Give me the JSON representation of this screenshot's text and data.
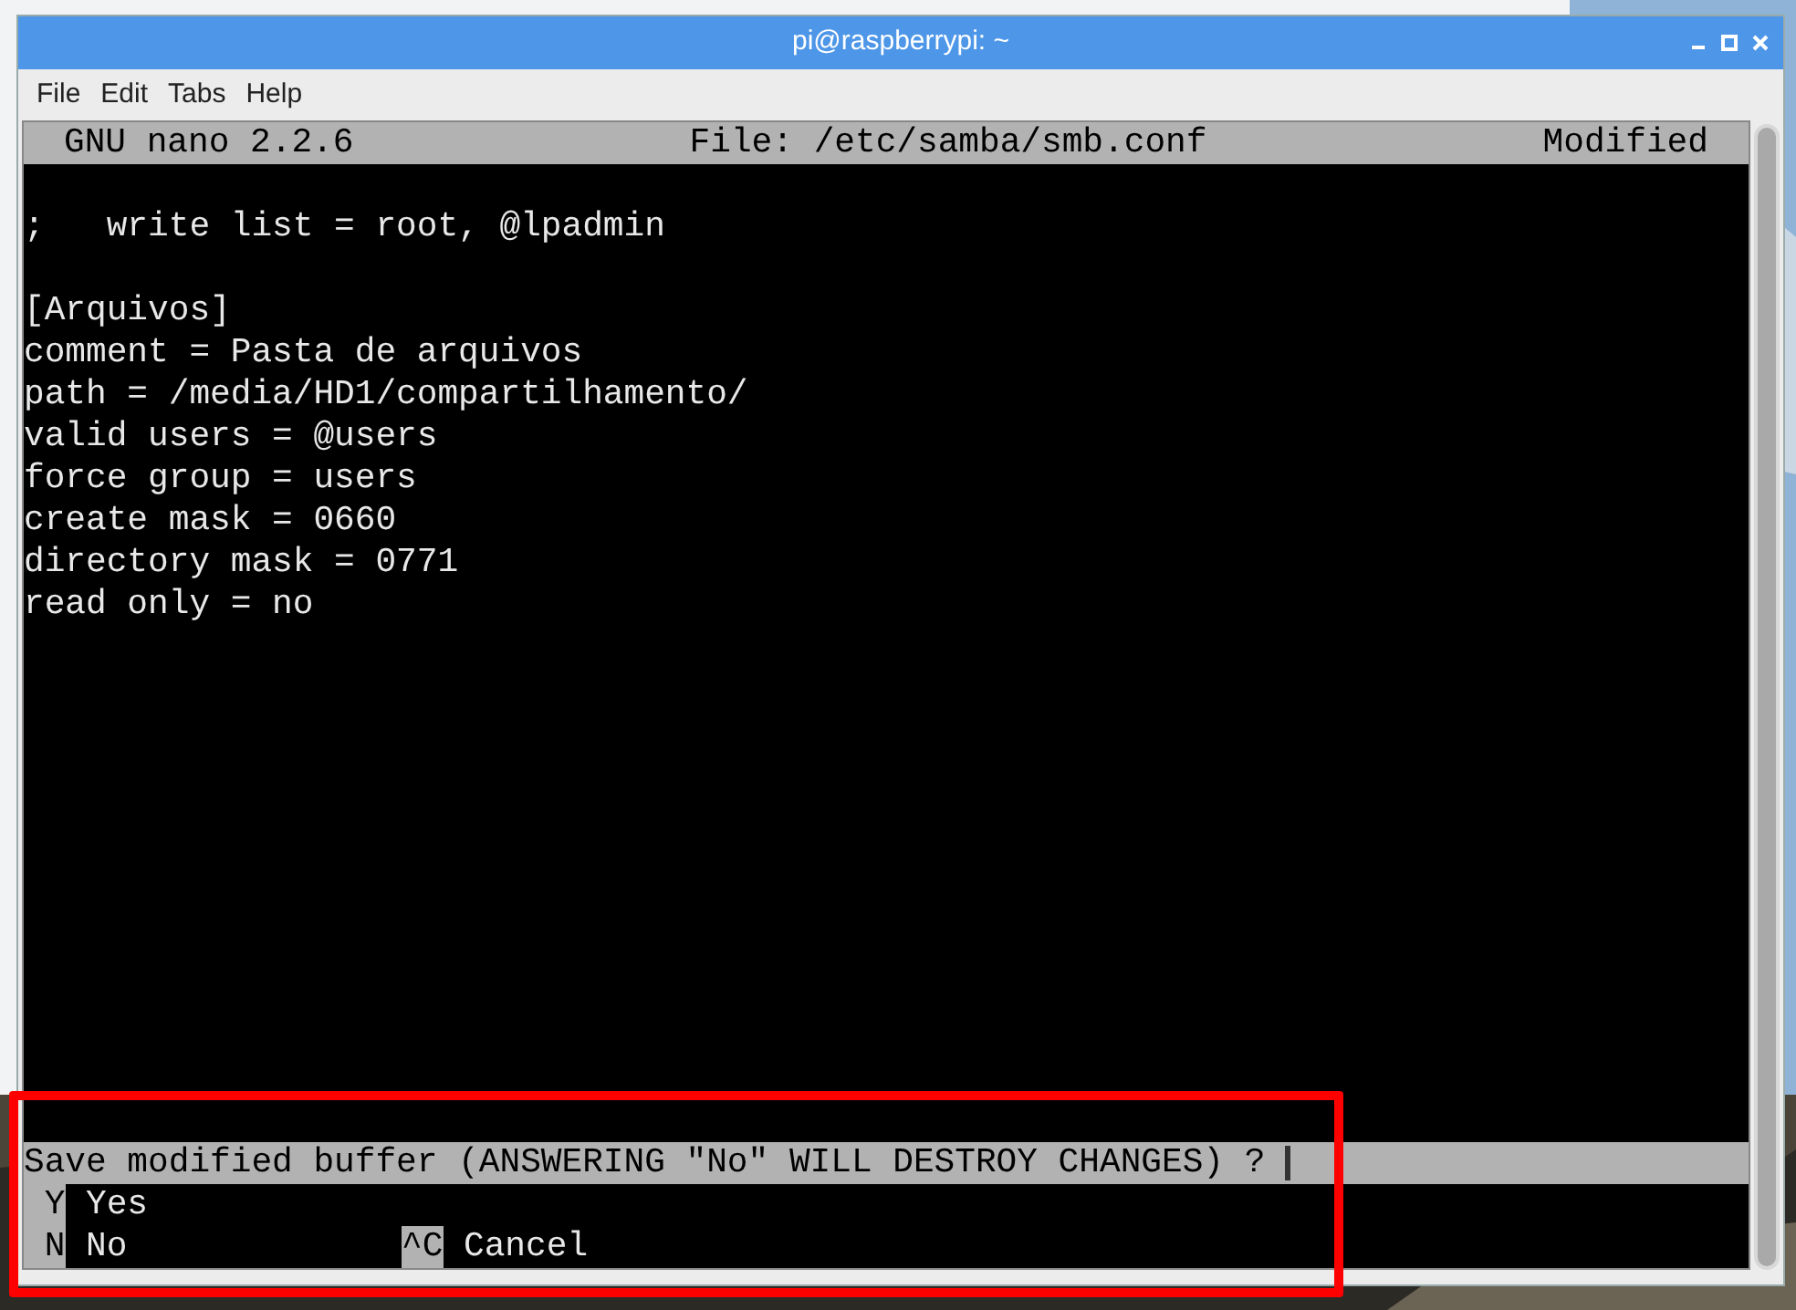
{
  "window": {
    "title": "pi@raspberrypi: ~"
  },
  "menu": [
    "File",
    "Edit",
    "Tabs",
    "Help"
  ],
  "nano": {
    "version": "GNU nano 2.2.6",
    "file": "File: /etc/samba/smb.conf",
    "status": "Modified"
  },
  "sections": [
    {
      "lines": [
        ";   write list = root, @lpadmin"
      ]
    },
    {
      "lines": [
        "[Arquivos]",
        "comment = Pasta de arquivos",
        "path = /media/HD1/compartilhamento/",
        "valid users = @users",
        "force group = users",
        "create mask = 0660",
        "directory mask = 0771",
        "read only = no"
      ]
    }
  ],
  "prompt": {
    "question": "Save modified buffer (ANSWERING \"No\" WILL DESTROY CHANGES) ?",
    "highlighted": true,
    "rows": [
      [
        {
          "key": "Y",
          "label": "Yes"
        }
      ],
      [
        {
          "key": "N",
          "label": "No"
        },
        {
          "key": "^C",
          "label": "Cancel"
        }
      ]
    ]
  }
}
